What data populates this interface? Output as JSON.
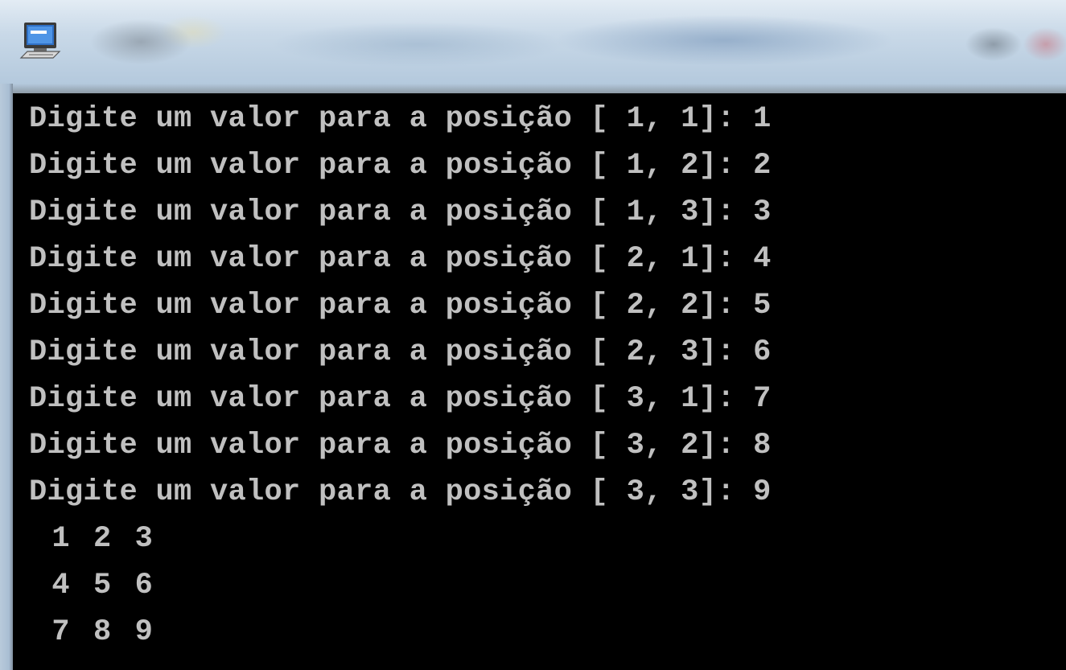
{
  "window": {
    "icon": "console-app-icon"
  },
  "console": {
    "prompt_lines": [
      "Digite um valor para a posição [ 1, 1]: 1",
      "Digite um valor para a posição [ 1, 2]: 2",
      "Digite um valor para a posição [ 1, 3]: 3",
      "Digite um valor para a posição [ 2, 1]: 4",
      "Digite um valor para a posição [ 2, 2]: 5",
      "Digite um valor para a posição [ 2, 3]: 6",
      "Digite um valor para a posição [ 3, 1]: 7",
      "Digite um valor para a posição [ 3, 2]: 8",
      "Digite um valor para a posição [ 3, 3]: 9"
    ],
    "matrix_rows": [
      "  1  2  3",
      "  4  5  6",
      "  7  8  9"
    ],
    "text_color": "#c0c0c0",
    "background_color": "#000000"
  }
}
